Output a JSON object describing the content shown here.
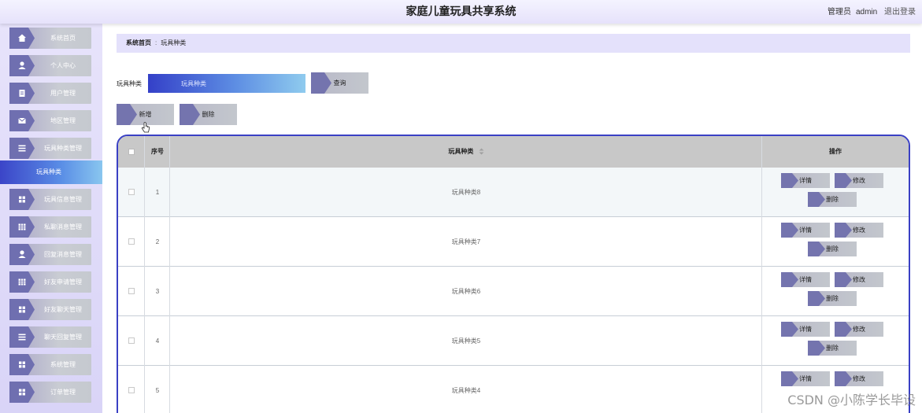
{
  "header": {
    "title": "家庭儿童玩具共享系统",
    "role": "管理员",
    "username": "admin",
    "logout": "退出登录"
  },
  "sidebar": {
    "items": [
      {
        "label": "系统首页",
        "icon": "home-icon"
      },
      {
        "label": "个人中心",
        "icon": "person-icon"
      },
      {
        "label": "用户管理",
        "icon": "document-icon"
      },
      {
        "label": "地区管理",
        "icon": "envelope-icon"
      },
      {
        "label": "玩具种类管理",
        "icon": "list-icon"
      },
      {
        "label": "玩具信息管理",
        "icon": "grid-icon"
      },
      {
        "label": "私聊消息管理",
        "icon": "table-icon"
      },
      {
        "label": "回复消息管理",
        "icon": "person-icon"
      },
      {
        "label": "好友申请管理",
        "icon": "table-icon"
      },
      {
        "label": "好友聊天管理",
        "icon": "grid-icon"
      },
      {
        "label": "聊天回复管理",
        "icon": "list-icon"
      },
      {
        "label": "系统管理",
        "icon": "grid-icon"
      },
      {
        "label": "订单管理",
        "icon": "grid-icon"
      }
    ],
    "active_sub": "玩具种类"
  },
  "breadcrumb": {
    "home": "系统首页",
    "separator": ":",
    "current": "玩具种类"
  },
  "search": {
    "label": "玩具种类",
    "placeholder": "玩具种类",
    "button": "查询"
  },
  "actions": {
    "add": "新增",
    "delete": "删除"
  },
  "table": {
    "columns": {
      "index": "序号",
      "category": "玩具种类",
      "sort_icon": "sort-icon",
      "operation": "操作"
    },
    "rows": [
      {
        "index": "1",
        "category": "玩具种类8"
      },
      {
        "index": "2",
        "category": "玩具种类7"
      },
      {
        "index": "3",
        "category": "玩具种类6"
      },
      {
        "index": "4",
        "category": "玩具种类5"
      },
      {
        "index": "5",
        "category": "玩具种类4"
      }
    ],
    "row_actions": {
      "detail": "详情",
      "edit": "修改",
      "delete": "删除"
    }
  },
  "watermark": "CSDN @小陈学长毕设",
  "colors": {
    "accent": "#3a40c4",
    "sidebar_bg": "#e7e3fb",
    "button_bg": "#c3c7cd",
    "active_item": "#5a8ee6"
  }
}
